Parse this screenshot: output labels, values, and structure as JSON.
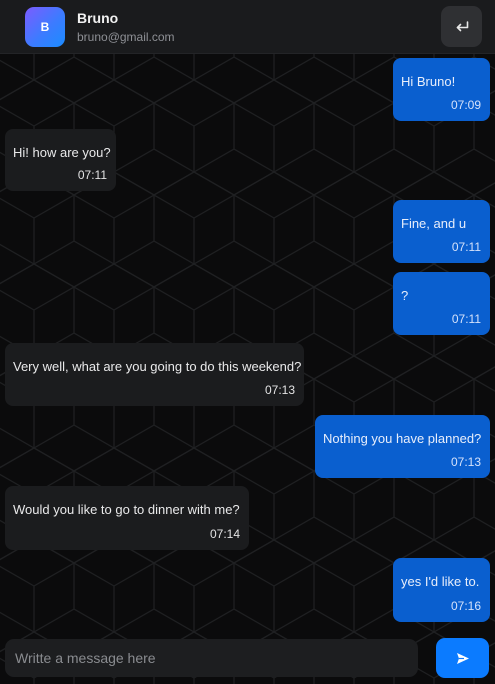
{
  "contact": {
    "initial": "B",
    "name": "Bruno",
    "email": "bruno@gmail.com"
  },
  "icons": {
    "back": "return-arrow-icon",
    "send": "send-icon"
  },
  "colors": {
    "accent": "#0b7bff",
    "outgoing_bubble": "#0a5fcf",
    "incoming_bubble": "#1b1c1e",
    "header": "#1a1b1d"
  },
  "messages": [
    {
      "direction": "out",
      "text": "Hi Bruno!",
      "time": "07:09"
    },
    {
      "direction": "in",
      "text": "Hi! how are you?",
      "time": "07:11"
    },
    {
      "direction": "out",
      "text": "Fine, and u",
      "time": "07:11"
    },
    {
      "direction": "out",
      "text": "?",
      "time": "07:11"
    },
    {
      "direction": "in",
      "text": "Very well, what are you going to do this weekend?",
      "time": "07:13"
    },
    {
      "direction": "out",
      "text": "Nothing you have planned?",
      "time": "07:13"
    },
    {
      "direction": "in",
      "text": "Would you like to go to dinner with me?",
      "time": "07:14"
    },
    {
      "direction": "out",
      "text": "yes I'd like to.",
      "time": "07:16"
    }
  ],
  "composer": {
    "placeholder": "Writte a message here",
    "value": ""
  }
}
